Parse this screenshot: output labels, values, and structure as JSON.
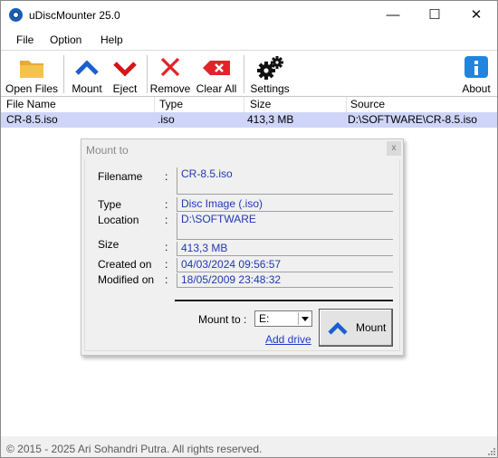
{
  "window": {
    "title": "uDiscMounter 25.0",
    "controls": {
      "minimize": "—",
      "maximize": "☐",
      "close": "✕"
    }
  },
  "menu": {
    "items": [
      "File",
      "Option",
      "Help"
    ]
  },
  "toolbar": {
    "open_files": "Open Files",
    "mount": "Mount",
    "eject": "Eject",
    "remove": "Remove",
    "clear_all": "Clear All",
    "settings": "Settings",
    "about": "About"
  },
  "list": {
    "columns": [
      "File Name",
      "Type",
      "Size",
      "Source"
    ],
    "rows": [
      {
        "file_name": "CR-8.5.iso",
        "type": ".iso",
        "size": "413,3 MB",
        "source": "D:\\SOFTWARE\\CR-8.5.iso"
      }
    ]
  },
  "dialog": {
    "title": "Mount to",
    "close": "x",
    "fields": [
      {
        "label": "Filename",
        "value": "CR-8.5.iso"
      },
      {
        "label": "Type",
        "value": "Disc Image (.iso)"
      },
      {
        "label": "Location",
        "value": "D:\\SOFTWARE"
      },
      {
        "label": "Size",
        "value": "413,3 MB"
      },
      {
        "label": "Created on",
        "value": "04/03/2024 09:56:57"
      },
      {
        "label": "Modified on",
        "value": "18/05/2009 23:48:32"
      }
    ],
    "colon": ":",
    "mount_to_label": "Mount to :",
    "drive_value": "E:",
    "add_drive": "Add drive",
    "mount_button": "Mount"
  },
  "footer": {
    "copyright": "© 2015 - 2025 Ari Sohandri Putra. All rights reserved."
  },
  "colors": {
    "accent_blue": "#1a5fb4",
    "selection": "#cfd5f8",
    "value_text": "#1f38b3",
    "eject_red": "#d6141a",
    "link": "#1a3cc9"
  },
  "icons": {
    "app": "disc-icon",
    "open_files": "folder-icon",
    "mount": "chevron-up-icon",
    "eject": "chevron-down-icon",
    "remove": "x-icon",
    "clear_all": "clear-tag-icon",
    "settings": "gears-icon",
    "about": "info-icon"
  }
}
